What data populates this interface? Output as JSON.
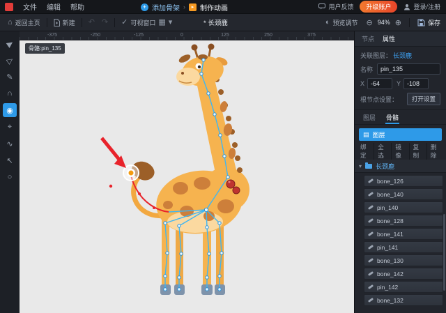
{
  "menubar": {
    "menus": [
      "文件",
      "编辑",
      "帮助"
    ],
    "workflow": {
      "step1": "添加骨架",
      "arrow": "›",
      "step2": "制作动画"
    },
    "feedback": "用户反馈",
    "upgrade": "升级账户",
    "login": "登录/注册"
  },
  "toolbar": {
    "home": "返回主页",
    "new": "新建",
    "visible_window": "可视窗口",
    "doc_tab": "* 长颈鹿",
    "preview": "预览调节",
    "zoom_value": "94%",
    "save": "保存"
  },
  "icons": {
    "plus": "+",
    "film": "▸",
    "home": "⌂",
    "undo": "↶",
    "redo": "↷",
    "check": "✓",
    "grid": "▦",
    "caret_down": "▾",
    "preview": "◐",
    "zoom_out": "⊖",
    "zoom_in": "⊕",
    "list": "▤"
  },
  "tools": [
    {
      "name": "select-tool",
      "glyph": "▶"
    },
    {
      "name": "node-select-tool",
      "glyph": "▷"
    },
    {
      "name": "pen-tool",
      "glyph": "✎"
    },
    {
      "name": "magnet-tool",
      "glyph": "∩"
    },
    {
      "name": "pin-tool",
      "glyph": "◉",
      "active": true
    },
    {
      "name": "bone-tool",
      "glyph": "⌖"
    },
    {
      "name": "curve-tool",
      "glyph": "∿"
    },
    {
      "name": "cursor-tool",
      "glyph": "↖"
    },
    {
      "name": "zoom-tool",
      "glyph": "○"
    }
  ],
  "ruler": {
    "ticks": [
      "-375",
      "-250",
      "-125",
      "0",
      "125",
      "250",
      "375"
    ]
  },
  "canvas": {
    "tooltip": "骨骼:pin_135"
  },
  "inspector": {
    "tab_node": "节点",
    "tab_props": "属性",
    "linked_label": "关联图层：",
    "linked_value": "长颈鹿",
    "name_label": "名称",
    "name_value": "pin_135",
    "x_label": "X",
    "x_value": "-64",
    "y_label": "Y",
    "y_value": "-108",
    "root_label": "根节点设置：",
    "root_button": "打开设置"
  },
  "panel": {
    "tab_layers": "图层",
    "tab_bones": "骨骼",
    "layer_bar": "图层",
    "actions": [
      "绑定",
      "全选",
      "镜像",
      "复制",
      "删除"
    ],
    "root": "长颈鹿",
    "items": [
      "bone_126",
      "bone_140",
      "pin_140",
      "bone_128",
      "bone_141",
      "pin_141",
      "bone_130",
      "bone_142",
      "pin_142",
      "bone_132"
    ]
  },
  "colors": {
    "accent": "#2E9AE8",
    "upgrade_button": "#F2612E",
    "selection_red": "#E8232B",
    "bone_blue": "#3FB6F2",
    "pin_orange": "#F49B0F",
    "giraffe_body": "#F6B34F",
    "giraffe_spots": "#CD7F3A"
  }
}
